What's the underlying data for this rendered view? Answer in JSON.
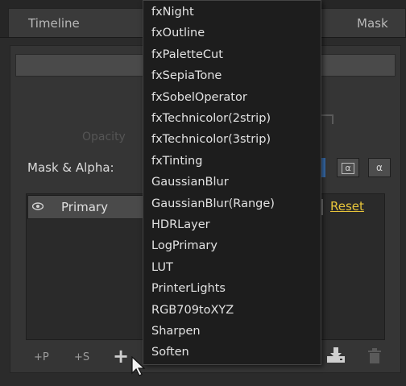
{
  "tabs": {
    "timeline": "Timeline",
    "mask": "Mask"
  },
  "panel": {
    "opacity_label": "Opacity",
    "mask_alpha_label": "Mask & Alpha:",
    "alpha_button_1": "α",
    "alpha_button_2": "α",
    "layer_name": "Primary",
    "reset_label": "Reset"
  },
  "bottom_bar": {
    "add_primary": "+P",
    "add_secondary": "+S",
    "add_effect": "+"
  },
  "dropdown": {
    "items": [
      "fxNight",
      "fxOutline",
      "fxPaletteCut",
      "fxSepiaTone",
      "fxSobelOperator",
      "fxTechnicolor(2strip)",
      "fxTechnicolor(3strip)",
      "fxTinting",
      "GaussianBlur",
      "GaussianBlur(Range)",
      "HDRLayer",
      "LogPrimary",
      "LUT",
      "PrinterLights",
      "RGB709toXYZ",
      "Sharpen",
      "Soften"
    ]
  },
  "colors": {
    "accent_reset": "#e8c53a",
    "menu_background": "#1d1d1d",
    "panel_background": "#353535"
  },
  "icons": {
    "eye": "eye-icon",
    "download": "download-icon",
    "trash": "trash-icon",
    "cursor": "mouse-cursor-icon"
  }
}
